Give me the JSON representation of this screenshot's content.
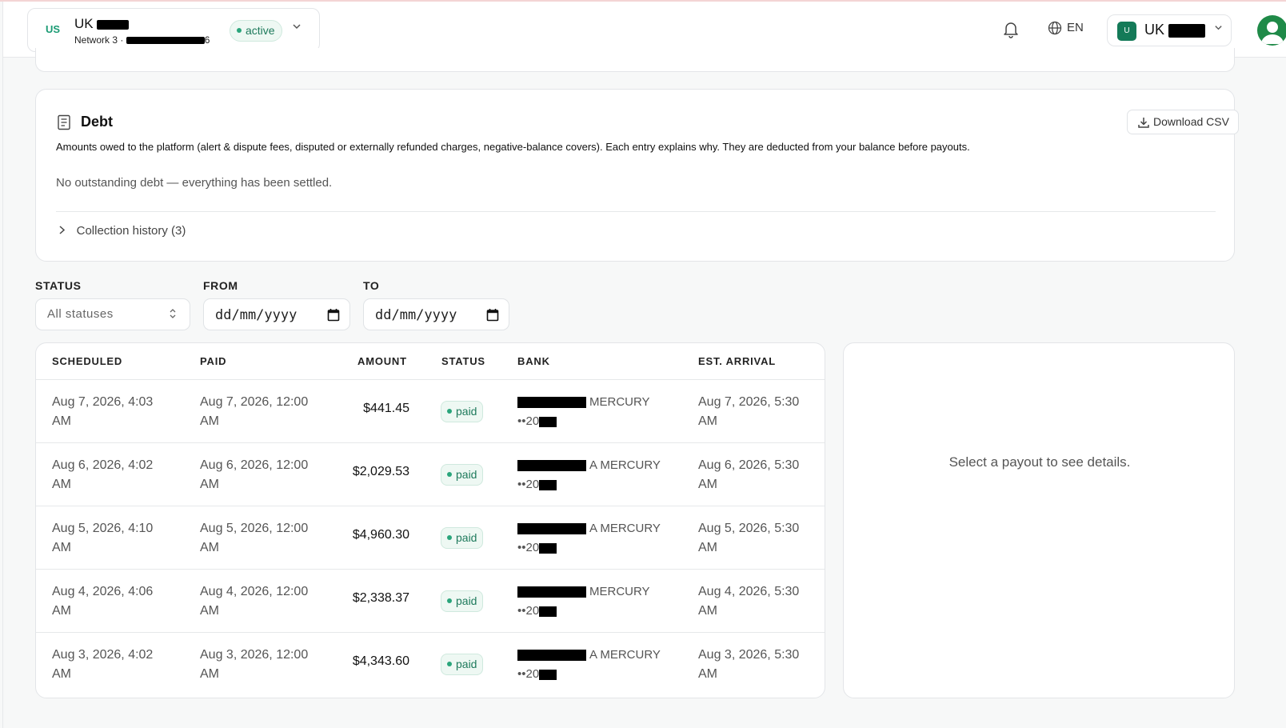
{
  "header": {
    "shop": {
      "code": "US",
      "name": "UK",
      "network": "Network 3",
      "id_suffix": "6",
      "status": "active"
    },
    "language": "EN",
    "account": {
      "badge": "U",
      "name": "UK"
    }
  },
  "debt": {
    "title": "Debt",
    "download_label": "Download CSV",
    "description": "Amounts owed to the platform (alert & dispute fees, disputed or externally refunded charges, negative-balance covers). Each entry explains why. They are deducted from your balance before payouts.",
    "empty_message": "No outstanding debt — everything has been settled.",
    "history_label": "Collection history (3)"
  },
  "filters": {
    "status_label": "STATUS",
    "status_value": "All statuses",
    "from_label": "FROM",
    "from_value": "dd/mm/yyyy",
    "to_label": "TO",
    "to_value": "dd/mm/yyyy"
  },
  "table": {
    "columns": [
      "SCHEDULED",
      "PAID",
      "AMOUNT",
      "STATUS",
      "BANK",
      "EST. ARRIVAL"
    ],
    "rows": [
      {
        "scheduled": "Aug 7, 2026, 4:03",
        "scheduled_2": "AM",
        "paid": "Aug 7, 2026, 12:00",
        "paid_2": "AM",
        "amount": "$441.45",
        "status": "paid",
        "bank": "MERCURY",
        "bank_acct": "••20",
        "arrival": "Aug 7, 2026, 5:30",
        "arrival_2": "AM"
      },
      {
        "scheduled": "Aug 6, 2026, 4:02",
        "scheduled_2": "AM",
        "paid": "Aug 6, 2026, 12:00",
        "paid_2": "AM",
        "amount": "$2,029.53",
        "status": "paid",
        "bank": "A MERCURY",
        "bank_acct": "••20",
        "arrival": "Aug 6, 2026, 5:30",
        "arrival_2": "AM"
      },
      {
        "scheduled": "Aug 5, 2026, 4:10",
        "scheduled_2": "AM",
        "paid": "Aug 5, 2026, 12:00",
        "paid_2": "AM",
        "amount": "$4,960.30",
        "status": "paid",
        "bank": "A MERCURY",
        "bank_acct": "••20",
        "arrival": "Aug 5, 2026, 5:30",
        "arrival_2": "AM"
      },
      {
        "scheduled": "Aug 4, 2026, 4:06",
        "scheduled_2": "AM",
        "paid": "Aug 4, 2026, 12:00",
        "paid_2": "AM",
        "amount": "$2,338.37",
        "status": "paid",
        "bank": "MERCURY",
        "bank_acct": "••20",
        "arrival": "Aug 4, 2026, 5:30",
        "arrival_2": "AM"
      },
      {
        "scheduled": "Aug 3, 2026, 4:02",
        "scheduled_2": "AM",
        "paid": "Aug 3, 2026, 12:00",
        "paid_2": "AM",
        "amount": "$4,343.60",
        "status": "paid",
        "bank": "A MERCURY",
        "bank_acct": "••20",
        "arrival": "Aug 3, 2026, 5:30",
        "arrival_2": "AM"
      }
    ]
  },
  "details": {
    "empty_message": "Select a payout to see details."
  },
  "colors": {
    "accent": "#1b9b74",
    "badge_bg": "#147a58",
    "pill_bg": "#eef8f3",
    "pill_text": "#1e7a5c"
  }
}
